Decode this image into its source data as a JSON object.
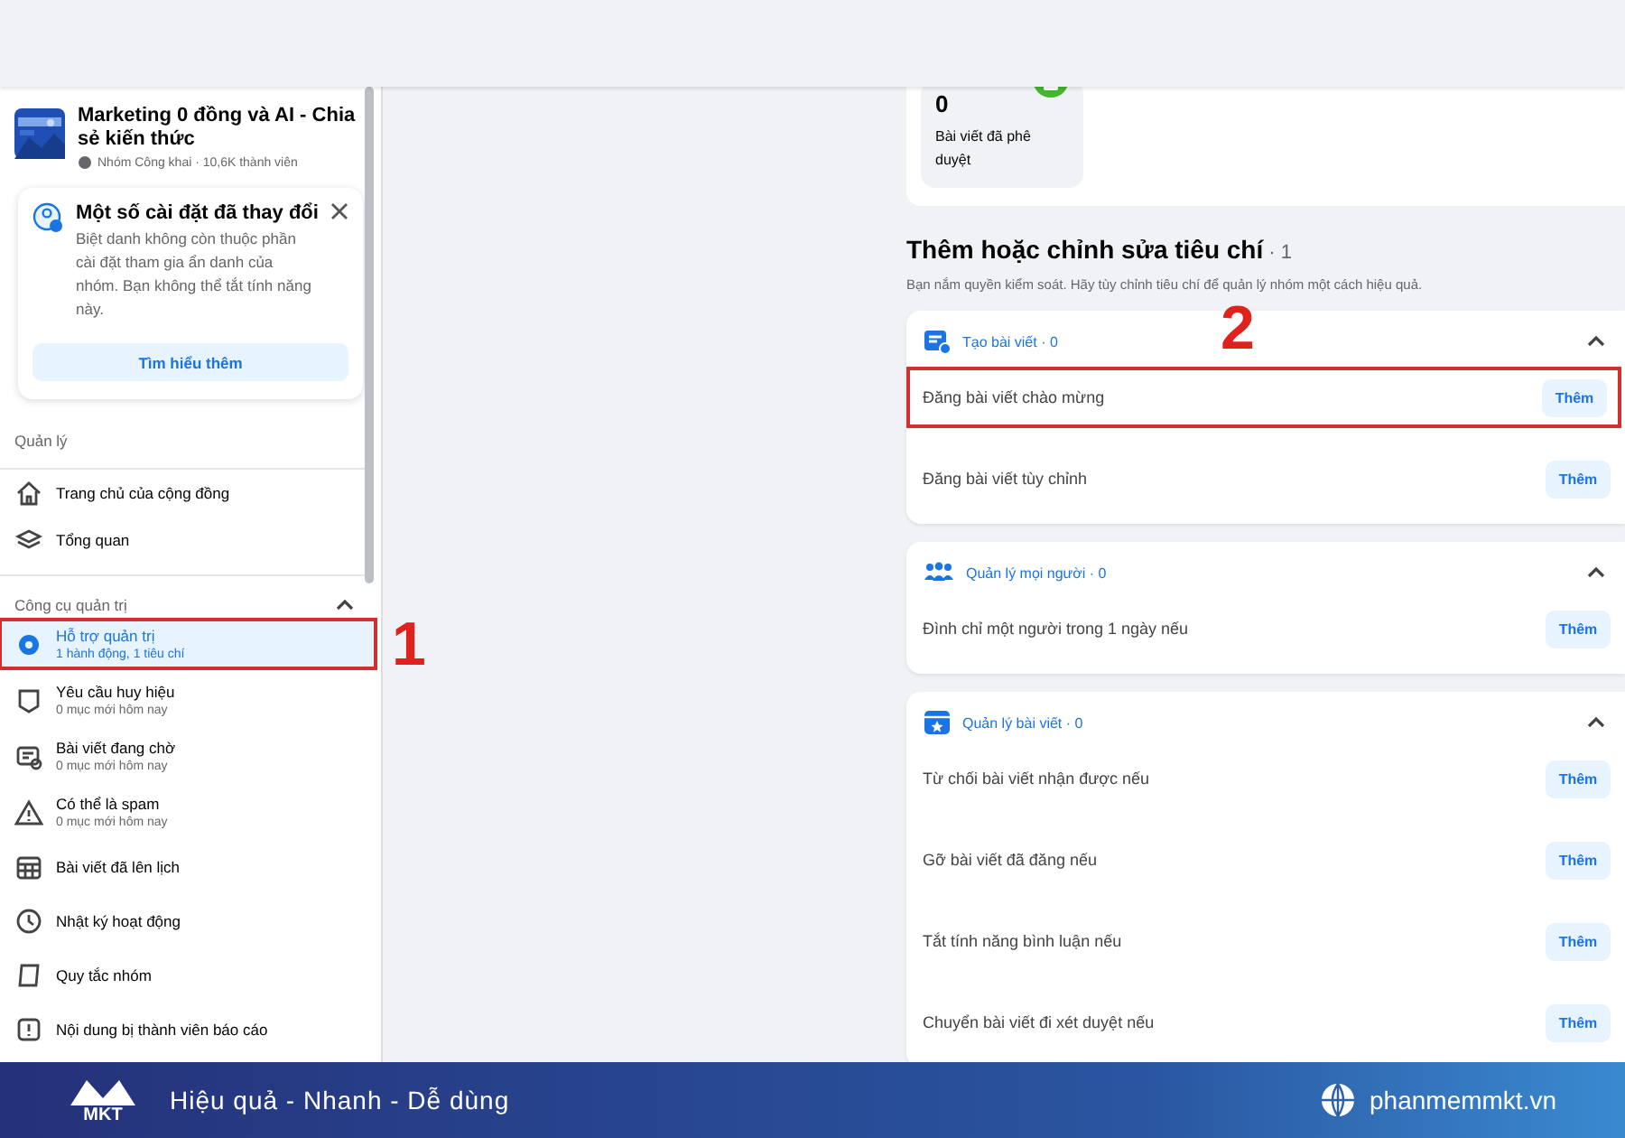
{
  "group": {
    "name": "Marketing 0 đồng và AI - Chia sẻ kiến thức",
    "meta": "Nhóm Công khai · 10,6K thành viên"
  },
  "notice": {
    "title": "Một số cài đặt đã thay đổi",
    "body": "Biệt danh không còn thuộc phần cài đặt tham gia ẩn danh của nhóm. Bạn không thể tắt tính năng này.",
    "button": "Tìm hiểu thêm"
  },
  "sidebar": {
    "section": "Quản lý",
    "items": [
      {
        "label": "Trang chủ của cộng đồng"
      },
      {
        "label": "Tổng quan"
      }
    ],
    "tools_title": "Công cụ quản trị",
    "tools_expanded": true,
    "tools": [
      {
        "label": "Hỗ trợ quản trị",
        "sub": "1 hành động, 1 tiêu chí",
        "selected": true,
        "annotation": "1"
      },
      {
        "label": "Yêu cầu huy hiệu",
        "sub": "0 mục mới hôm nay",
        "selected": false
      },
      {
        "label": "Bài viết đang chờ",
        "sub": "0 mục mới hôm nay",
        "selected": false
      },
      {
        "label": "Có thể là spam",
        "sub": "0 mục mới hôm nay",
        "selected": false
      },
      {
        "label": "Bài viết đã lên lịch",
        "selected": false
      },
      {
        "label": "Nhật ký hoạt động",
        "selected": false
      },
      {
        "label": "Quy tắc nhóm",
        "selected": false
      },
      {
        "label": "Nội dung bị thành viên báo cáo",
        "selected": false
      }
    ]
  },
  "stat": {
    "value": "0",
    "label": "Bài viết đã phê duyệt"
  },
  "criteria": {
    "title": "Thêm hoặc chỉnh sửa tiêu chí",
    "count": "· 1",
    "description": "Bạn nắm quyền kiểm soát. Hãy tùy chỉnh tiêu chí để quản lý nhóm một cách hiệu quả.",
    "groups": [
      {
        "title": "Tạo bài viết · 0",
        "expanded": true,
        "rows": [
          {
            "label": "Đăng bài viết chào mừng",
            "button": "Thêm",
            "annotation": "2"
          },
          {
            "label": "Đăng bài viết tùy chỉnh",
            "button": "Thêm"
          }
        ]
      },
      {
        "title": "Quản lý mọi người · 0",
        "expanded": true,
        "rows": [
          {
            "label": "Đình chỉ một người trong 1 ngày nếu",
            "button": "Thêm"
          }
        ]
      },
      {
        "title": "Quản lý bài viết · 0",
        "expanded": true,
        "rows": [
          {
            "label": "Từ chối bài viết nhận được nếu",
            "button": "Thêm"
          },
          {
            "label": "Gỡ bài viết đã đăng nếu",
            "button": "Thêm"
          },
          {
            "label": "Tắt tính năng bình luận nếu",
            "button": "Thêm"
          },
          {
            "label": "Chuyển bài viết đi xét duyệt nếu",
            "button": "Thêm"
          }
        ]
      }
    ]
  },
  "banner": {
    "logo": "MKT",
    "slogan": "Hiệu quả - Nhanh - Dễ dùng",
    "website": "phanmemmkt.vn"
  }
}
